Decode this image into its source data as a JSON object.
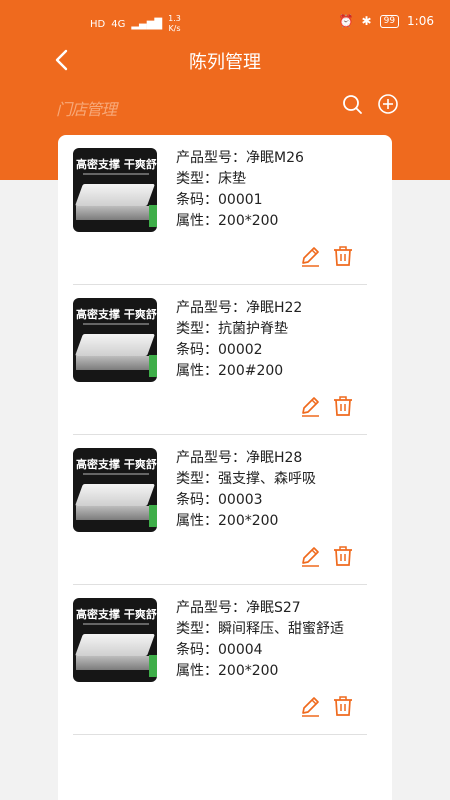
{
  "status_bar": {
    "hd_label": "HD",
    "signal_label": "4G",
    "net_speed_value": "1.3",
    "net_speed_unit": "K/s",
    "battery": "99",
    "time": "1:06"
  },
  "header": {
    "title": "陈列管理",
    "store_label": "门店管理"
  },
  "icons": {
    "back": "back-arrow-icon",
    "search": "search-icon",
    "add": "add-circle-icon",
    "edit": "edit-pencil-icon",
    "delete": "trash-icon"
  },
  "colors": {
    "brand": "#ef6a1e",
    "panel": "#ffffff",
    "background": "#f2f2f2"
  },
  "product_image_text": "高密支撑 干爽舒睡",
  "products": [
    {
      "model_label": "产品型号：",
      "model": "净眠M26",
      "type_label": "类型：",
      "type": "床垫",
      "code_label": "条码：",
      "code": "00001",
      "attr_label": "属性：",
      "attr": "200*200"
    },
    {
      "model_label": "产品型号：",
      "model": "净眠H22",
      "type_label": "类型：",
      "type": "抗菌护脊垫",
      "code_label": "条码：",
      "code": "00002",
      "attr_label": "属性：",
      "attr": "200#200"
    },
    {
      "model_label": "产品型号：",
      "model": "净眠H28",
      "type_label": "类型：",
      "type": "强支撑、森呼吸",
      "code_label": "条码：",
      "code": "00003",
      "attr_label": "属性：",
      "attr": "200*200"
    },
    {
      "model_label": "产品型号：",
      "model": "净眠S27",
      "type_label": "类型：",
      "type": "瞬间释压、甜蜜舒适",
      "code_label": "条码：",
      "code": "00004",
      "attr_label": "属性：",
      "attr": "200*200"
    }
  ]
}
